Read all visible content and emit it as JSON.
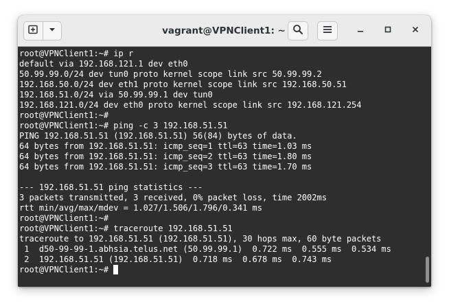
{
  "window": {
    "title": "vagrant@VPNClient1: ~"
  },
  "toolbar": {
    "new_tab_icon": "new-tab-icon",
    "menu_dropdown_icon": "chevron-down-icon",
    "search_icon": "search-icon",
    "hamburger_icon": "hamburger-menu-icon",
    "minimize_icon": "minimize-icon",
    "maximize_icon": "maximize-icon",
    "close_icon": "close-icon"
  },
  "terminal": {
    "lines": [
      "root@VPNClient1:~# ip r",
      "default via 192.168.121.1 dev eth0",
      "50.99.99.0/24 dev tun0 proto kernel scope link src 50.99.99.2",
      "192.168.50.0/24 dev eth1 proto kernel scope link src 192.168.50.51",
      "192.168.51.0/24 via 50.99.99.1 dev tun0",
      "192.168.121.0/24 dev eth0 proto kernel scope link src 192.168.121.254",
      "root@VPNClient1:~#",
      "root@VPNClient1:~# ping -c 3 192.168.51.51",
      "PING 192.168.51.51 (192.168.51.51) 56(84) bytes of data.",
      "64 bytes from 192.168.51.51: icmp_seq=1 ttl=63 time=1.03 ms",
      "64 bytes from 192.168.51.51: icmp_seq=2 ttl=63 time=1.80 ms",
      "64 bytes from 192.168.51.51: icmp_seq=3 ttl=63 time=1.70 ms",
      "",
      "--- 192.168.51.51 ping statistics ---",
      "3 packets transmitted, 3 received, 0% packet loss, time 2002ms",
      "rtt min/avg/max/mdev = 1.027/1.506/1.796/0.341 ms",
      "root@VPNClient1:~#",
      "root@VPNClient1:~# traceroute 192.168.51.51",
      "traceroute to 192.168.51.51 (192.168.51.51), 30 hops max, 60 byte packets",
      " 1  d50-99-99-1.abhsia.telus.net (50.99.99.1)  0.722 ms  0.555 ms  0.534 ms",
      " 2  192.168.51.51 (192.168.51.51)  0.718 ms  0.678 ms  0.743 ms"
    ],
    "prompt": "root@VPNClient1:~# "
  },
  "colors": {
    "terminal_bg": "#2e2e2e",
    "terminal_fg": "#ffffff",
    "titlebar_bg": "#ebebeb"
  }
}
